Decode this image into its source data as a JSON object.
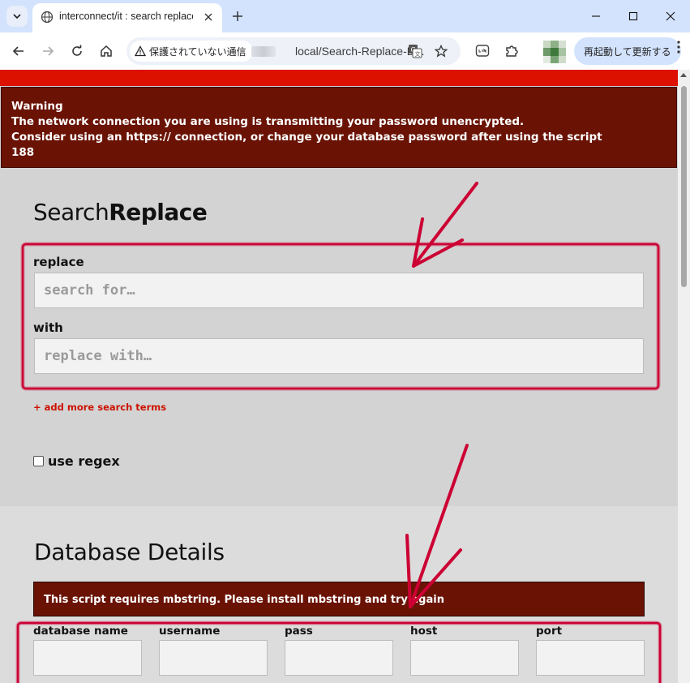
{
  "browser": {
    "tab_title": "interconnect/it : search replace",
    "security_label": "保護されていない通信",
    "url": "local/Search-Replace-D...",
    "relaunch_label": "再起動して更新する"
  },
  "warning": {
    "heading": "Warning",
    "line1": "The network connection you are using is transmitting your password unencrypted.",
    "line2": "Consider using an https:// connection, or change your database password after using the script",
    "line3": "188"
  },
  "search_replace": {
    "title_light": "Search",
    "title_bold": "Replace",
    "replace_label": "replace",
    "replace_placeholder": "search for…",
    "with_label": "with",
    "with_placeholder": "replace with…",
    "add_terms": "+ add more search terms",
    "regex_label": "use regex"
  },
  "database": {
    "title": "Database Details",
    "mb_warning": "This script requires mbstring. Please install mbstring and try again",
    "fields": [
      {
        "label": "database name"
      },
      {
        "label": "username"
      },
      {
        "label": "pass"
      },
      {
        "label": "host"
      },
      {
        "label": "port"
      }
    ]
  },
  "colors": {
    "warning_bg": "#6a1305",
    "accent_red": "#dd1100",
    "annotation": "#cc0033"
  }
}
